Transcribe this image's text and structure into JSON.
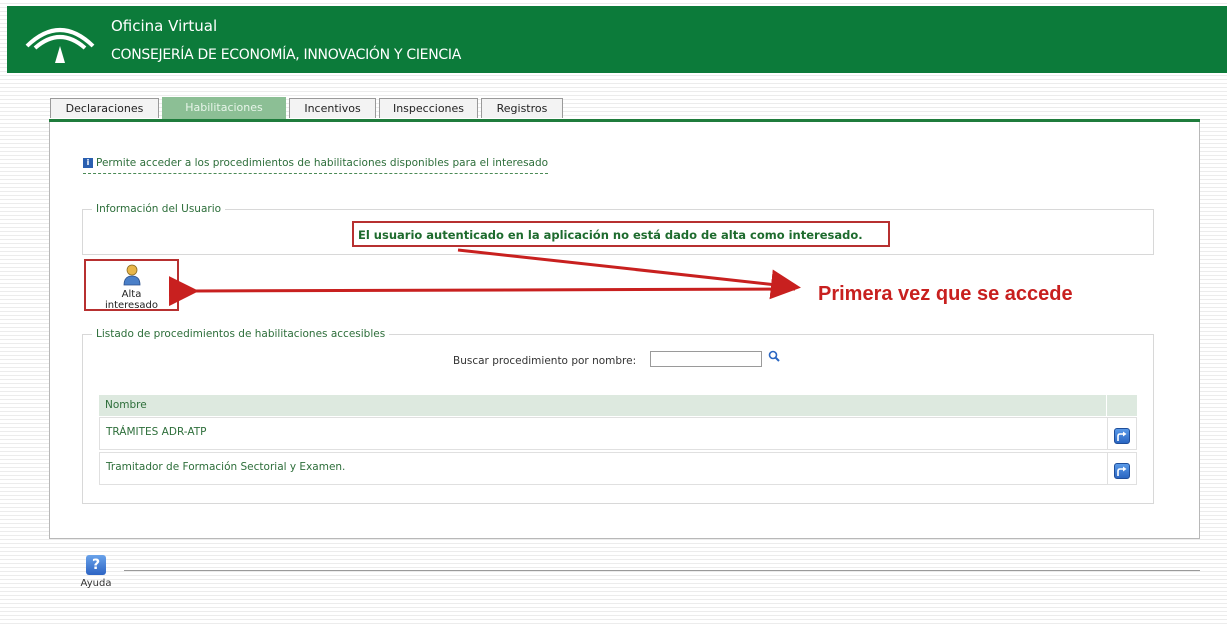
{
  "header": {
    "title": "Oficina Virtual",
    "subtitle": "CONSEJERÍA DE ECONOMÍA, INNOVACIÓN Y CIENCIA",
    "bg_color": "#0c7b3a"
  },
  "tabs": [
    {
      "label": "Declaraciones",
      "active": false
    },
    {
      "label": "Habilitaciones",
      "active": true
    },
    {
      "label": "Incentivos",
      "active": false
    },
    {
      "label": "Inspecciones",
      "active": false
    },
    {
      "label": "Registros",
      "active": false
    }
  ],
  "info": {
    "icon": "info-icon",
    "text": "Permite acceder a los procedimientos de habilitaciones disponibles para el interesado"
  },
  "user_info": {
    "legend": "Información del Usuario",
    "message": "El usuario autenticado en la aplicación no está dado de alta como interesado."
  },
  "alta": {
    "icon": "user-icon",
    "label_line1": "Alta",
    "label_line2": "interesado"
  },
  "annotation": {
    "text": "Primera vez que se accede",
    "color": "#c8201f"
  },
  "procedures": {
    "legend": "Listado de procedimientos de habilitaciones accesibles",
    "search_label": "Buscar procedimiento por nombre:",
    "search_value": "",
    "column_header": "Nombre",
    "rows": [
      {
        "name": "TRÁMITES ADR-ATP"
      },
      {
        "name": "Tramitador de Formación Sectorial y Examen."
      }
    ]
  },
  "help": {
    "icon": "help-icon",
    "label": "Ayuda"
  }
}
